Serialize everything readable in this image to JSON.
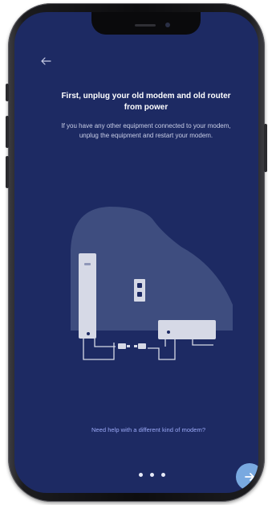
{
  "screen": {
    "title": "First, unplug your old modem and old router from power",
    "description": "If you have any other equipment connected to your modem, unplug the equipment and restart your modem.",
    "help_link": "Need help with a different kind of modem?"
  },
  "pagination": {
    "total": 3,
    "current": 1
  },
  "icons": {
    "back": "back-arrow-icon",
    "next": "right-arrow-icon"
  },
  "colors": {
    "background": "#1d2a63",
    "blob": "#3e4d7f",
    "link": "#9aa8f5",
    "next_button": "#79a9e0"
  }
}
